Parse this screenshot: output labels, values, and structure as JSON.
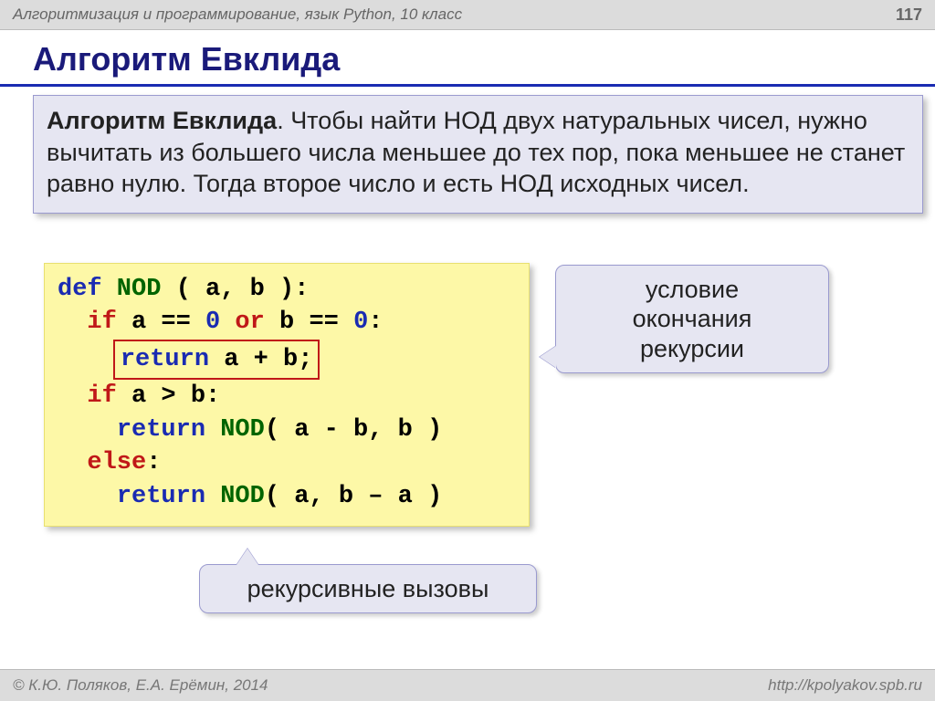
{
  "header": {
    "breadcrumb": "Алгоритмизация и программирование, язык Python, 10 класс",
    "page_number": "117"
  },
  "title": "Алгоритм Евклида",
  "description": {
    "lead": "Алгоритм Евклида",
    "body": ". Чтобы найти НОД двух натуральных чисел, нужно вычитать из большего числа меньшее до тех пор, пока меньшее не станет равно нулю. Тогда второе число и есть НОД исходных чисел."
  },
  "code": {
    "l1": {
      "def": "def",
      "fn": " NOD ",
      "rest": "( a, b ):"
    },
    "l2": {
      "indent": "  ",
      "if_": "if",
      "expr1": " a == ",
      "zero1": "0",
      "or_": " or ",
      "expr2": "b == ",
      "zero2": "0",
      "colon": ":"
    },
    "l3": {
      "indent": "    ",
      "ret": "return",
      "expr": " a + b;"
    },
    "l4": {
      "indent": "  ",
      "if_": "if",
      "expr": " a > b:"
    },
    "l5": {
      "indent": "    ",
      "ret": "return",
      "fn": " NOD",
      "args": "( a - b, b )"
    },
    "l6": {
      "indent": "  ",
      "else_": "else",
      "colon": ":"
    },
    "l7": {
      "indent": "    ",
      "ret": "return",
      "fn": " NOD",
      "args": "( a, b – a )"
    }
  },
  "callouts": {
    "termination": "условие\nокончания\nрекурсии",
    "recursive_calls": "рекурсивные вызовы"
  },
  "footer": {
    "left": "© К.Ю. Поляков, Е.А. Ерёмин, 2014",
    "right": "http://kpolyakov.spb.ru"
  }
}
